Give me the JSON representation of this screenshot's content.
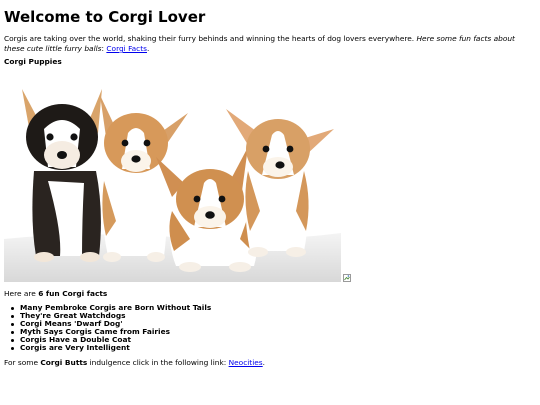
{
  "header": {
    "title": "Welcome to Corgi Lover"
  },
  "intro": {
    "text": "Corgis are taking over the world, shaking their furry behinds and winning the hearts of dog lovers everywhere. ",
    "emphasis": "Here some fun facts about these cute little furry balls",
    "colon": ": ",
    "link_label": "Corgi Facts",
    "end": "."
  },
  "section": {
    "heading": "Corgi Puppies"
  },
  "photo": {
    "icon": "corgi-puppies-photo"
  },
  "facts_intro": {
    "prefix": "Here are ",
    "bold": "6 fun Corgi facts"
  },
  "facts": [
    "Many Pembroke Corgis are Born Without Tails",
    "They're Great Watchdogs",
    "Corgi Means 'Dwarf Dog'",
    "Myth Says Corgis Came from Fairies",
    "Corgis Have a Double Coat",
    "Corgis are Very Intelligent"
  ],
  "outro": {
    "prefix": "For some ",
    "bold": "Corgi Butts",
    "middle": " indulgence click in the following link: ",
    "link_label": "Neocities",
    "end": "."
  },
  "colors": {
    "link": "#0000ee",
    "text": "#000000",
    "background": "#ffffff"
  }
}
